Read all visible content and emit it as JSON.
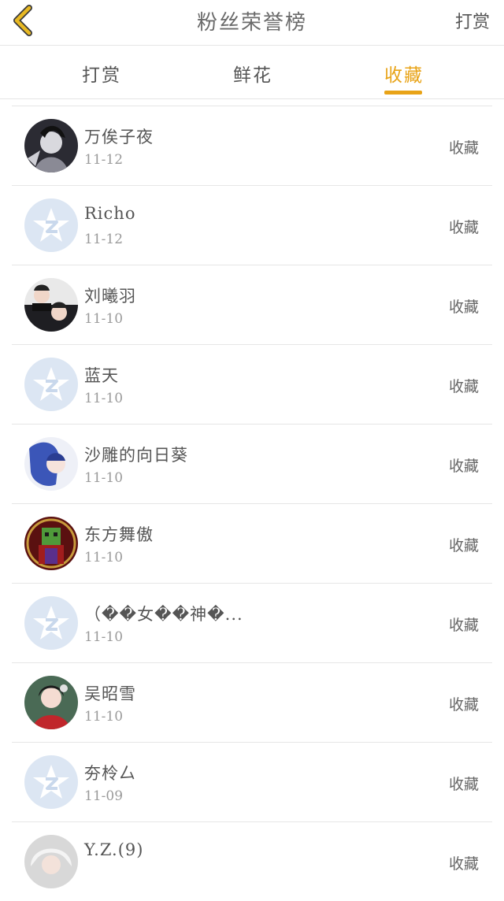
{
  "header": {
    "title": "粉丝荣誉榜",
    "action_label": "打赏",
    "back_icon": "chevron-left-icon",
    "back_icon_color": "#e8b923"
  },
  "tabs": [
    {
      "label": "打赏",
      "active": false
    },
    {
      "label": "鲜花",
      "active": false
    },
    {
      "label": "收藏",
      "active": true
    }
  ],
  "colors": {
    "accent": "#e8a317",
    "default_avatar_bg": "#dce6f3"
  },
  "list": [
    {
      "name": "万俟子夜",
      "date": "11-12",
      "type": "收藏",
      "avatar": "photo-dark-anime"
    },
    {
      "name": "Richo",
      "date": "11-12",
      "type": "收藏",
      "avatar": "default-qq-icon"
    },
    {
      "name": "刘曦羽",
      "date": "11-10",
      "type": "收藏",
      "avatar": "photo-two-boys"
    },
    {
      "name": "蓝天",
      "date": "11-10",
      "type": "收藏",
      "avatar": "default-qq-icon"
    },
    {
      "name": "沙雕的向日葵",
      "date": "11-10",
      "type": "收藏",
      "avatar": "photo-anime-blue-hair"
    },
    {
      "name": "东方舞傲",
      "date": "11-10",
      "type": "收藏",
      "avatar": "photo-red-game-character"
    },
    {
      "name": "（��女��神�...",
      "date": "11-10",
      "type": "收藏",
      "avatar": "default-qq-icon"
    },
    {
      "name": "吴昭雪",
      "date": "11-10",
      "type": "收藏",
      "avatar": "photo-girl-red-dress"
    },
    {
      "name": "夯柃厶",
      "date": "11-09",
      "type": "收藏",
      "avatar": "default-qq-icon"
    },
    {
      "name": "Y.Z.(9)",
      "date": "",
      "type": "收藏",
      "avatar": "photo-white-hair"
    }
  ]
}
